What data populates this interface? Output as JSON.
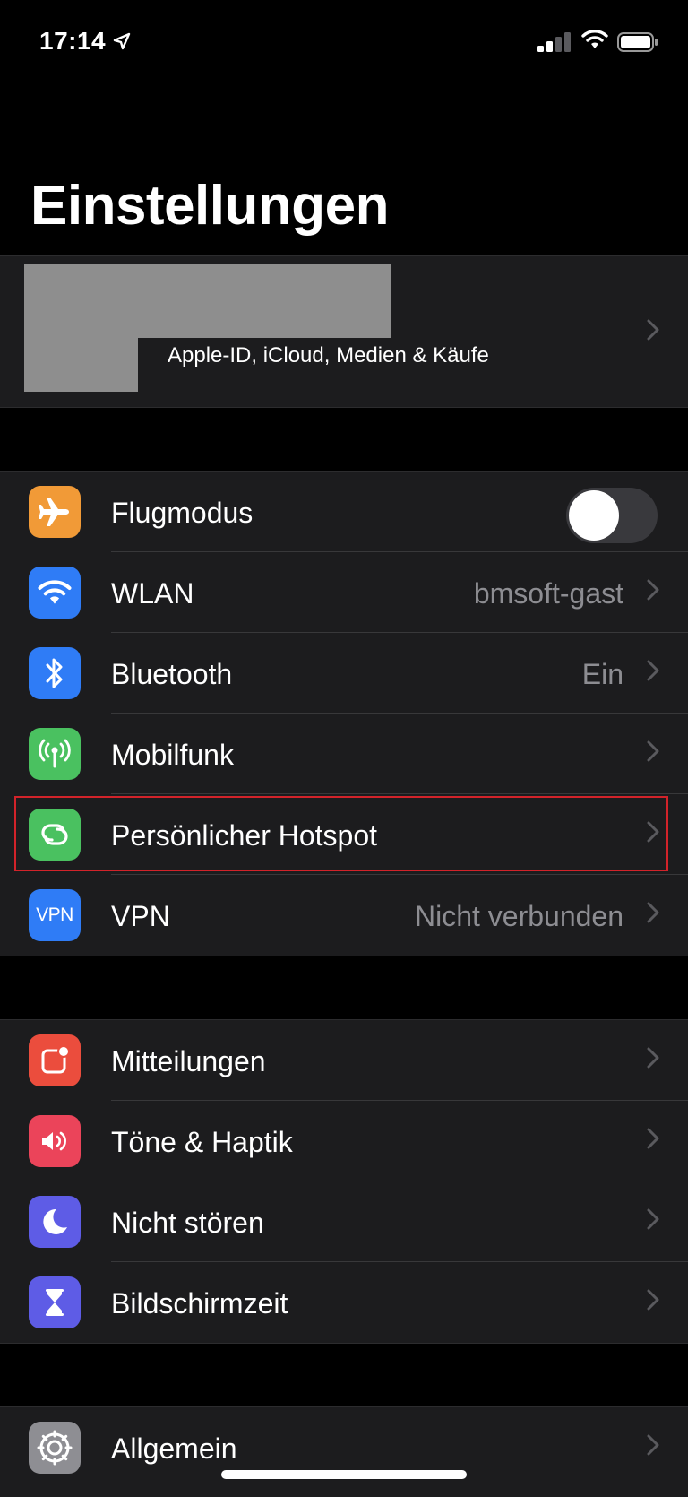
{
  "status_bar": {
    "time": "17:14",
    "location_icon": "location-arrow-icon",
    "signal_icon": "cellular-signal-icon",
    "wifi_icon": "wifi-icon",
    "battery_icon": "battery-icon"
  },
  "page_title": "Einstellungen",
  "profile": {
    "subtitle": "Apple-ID, iCloud, Medien & Käufe"
  },
  "connectivity": [
    {
      "label": "Flugmodus",
      "icon": "airplane-icon",
      "color": "#f19a37",
      "toggle": false
    },
    {
      "label": "WLAN",
      "value": "bmsoft-gast",
      "icon": "wifi-icon",
      "color": "#2f7cf6"
    },
    {
      "label": "Bluetooth",
      "value": "Ein",
      "icon": "bluetooth-icon",
      "color": "#2f7cf6"
    },
    {
      "label": "Mobilfunk",
      "icon": "antenna-icon",
      "color": "#4ac160"
    },
    {
      "label": "Persönlicher Hotspot",
      "icon": "hotspot-link-icon",
      "color": "#4ac160"
    },
    {
      "label": "VPN",
      "value": "Nicht verbunden",
      "icon": "vpn-icon",
      "icon_text": "VPN",
      "color": "#2f7cf6"
    }
  ],
  "notifications": [
    {
      "label": "Mitteilungen",
      "icon": "notifications-icon",
      "color": "#eb4d3d"
    },
    {
      "label": "Töne & Haptik",
      "icon": "speaker-icon",
      "color": "#eb445a"
    },
    {
      "label": "Nicht stören",
      "icon": "moon-icon",
      "color": "#5e5ce6"
    },
    {
      "label": "Bildschirmzeit",
      "icon": "hourglass-icon",
      "color": "#5e5ce6"
    }
  ],
  "general": [
    {
      "label": "Allgemein",
      "icon": "gear-icon",
      "color": "#8e8e93"
    }
  ],
  "colors": {
    "background": "#000000",
    "cell_background": "#1c1c1e",
    "secondary_text": "#8d8d92",
    "highlight_border": "#d2232a"
  }
}
